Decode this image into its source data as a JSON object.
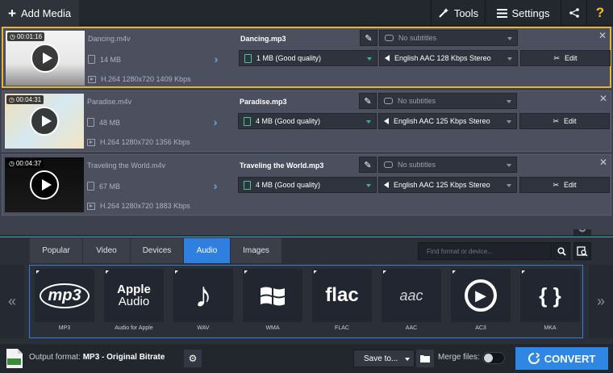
{
  "toolbar": {
    "add_media": "Add Media",
    "tools": "Tools",
    "settings": "Settings",
    "help": "?"
  },
  "files": [
    {
      "duration": "00:01:16",
      "source": "Dancing.m4v",
      "size": "14 MB",
      "info": "H.264 1280x720 1409 Kbps",
      "output": "Dancing.mp3",
      "out_size": "1 MB (Good quality)",
      "subtitles": "No subtitles",
      "audio": "English AAC 128 Kbps Stereo",
      "edit": "Edit",
      "selected": true
    },
    {
      "duration": "00:04:31",
      "source": "Paradise.m4v",
      "size": "48 MB",
      "info": "H.264 1280x720 1356 Kbps",
      "output": "Paradise.mp3",
      "out_size": "4 MB (Good quality)",
      "subtitles": "No subtitles",
      "audio": "English AAC 125 Kbps Stereo",
      "edit": "Edit",
      "selected": false
    },
    {
      "duration": "00:04:37",
      "source": "Traveling the World.m4v",
      "size": "67 MB",
      "info": "H.264 1280x720 1883 Kbps",
      "output": "Traveling the World.mp3",
      "out_size": "4 MB (Good quality)",
      "subtitles": "No subtitles",
      "audio": "English AAC 125 Kbps Stereo",
      "edit": "Edit",
      "selected": false
    }
  ],
  "tabs": [
    "Popular",
    "Video",
    "Devices",
    "Audio",
    "Images"
  ],
  "active_tab": "Audio",
  "search": {
    "placeholder": "Find format or device..."
  },
  "formats": [
    {
      "label": "MP3",
      "icon": "mp3-icon",
      "glyph": "mp3"
    },
    {
      "label": "Audio for Apple",
      "icon": "apple-audio-icon",
      "glyph": "Apple",
      "glyph2": "Audio"
    },
    {
      "label": "WAV",
      "icon": "music-note-icon",
      "glyph": "♪"
    },
    {
      "label": "WMA",
      "icon": "windows-icon",
      "glyph": ""
    },
    {
      "label": "FLAC",
      "icon": "flac-icon",
      "glyph": "flac"
    },
    {
      "label": "AAC",
      "icon": "aac-icon",
      "glyph": "aac"
    },
    {
      "label": "AC3",
      "icon": "ac3-icon",
      "glyph": "▶"
    },
    {
      "label": "MKA",
      "icon": "mka-icon",
      "glyph": "{ }"
    }
  ],
  "footer": {
    "output_label": "Output format:",
    "output_value": "MP3 - Original Bitrate",
    "save_to": "Save to...",
    "merge": "Merge files:",
    "convert": "CONVERT"
  },
  "colors": {
    "accent": "#2f86e3",
    "selection": "#e2b535",
    "panel": "#2b3038"
  }
}
